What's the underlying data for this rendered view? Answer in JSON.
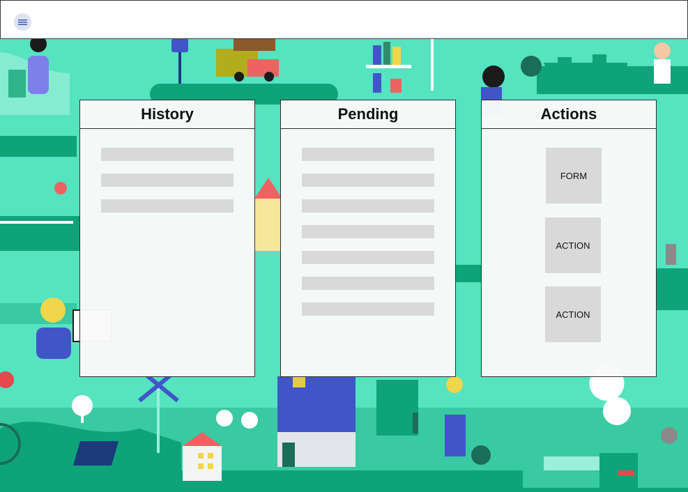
{
  "header": {
    "menu_icon": "hamburger-menu-icon"
  },
  "panels": {
    "history": {
      "title": "History",
      "row_count": 3
    },
    "pending": {
      "title": "Pending",
      "row_count": 7
    },
    "actions": {
      "title": "Actions",
      "buttons": [
        "FORM",
        "ACTION",
        "ACTION"
      ]
    }
  },
  "colors": {
    "background_mint": "#55e3c0",
    "background_dark_green": "#0fa37a",
    "placeholder_grey": "#d9d9d9",
    "panel_bg": "#fafafa"
  }
}
